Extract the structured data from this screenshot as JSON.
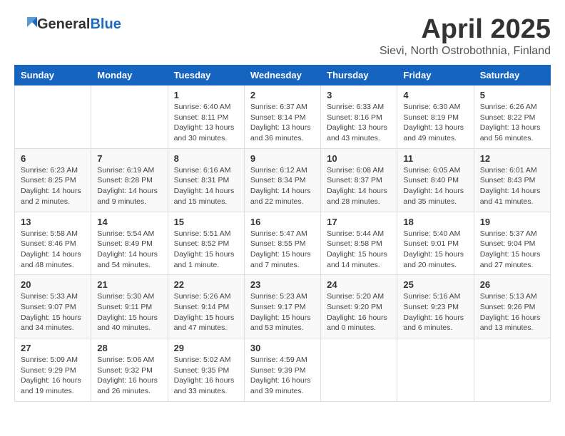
{
  "header": {
    "logo_general": "General",
    "logo_blue": "Blue",
    "title": "April 2025",
    "location": "Sievi, North Ostrobothnia, Finland"
  },
  "days_of_week": [
    "Sunday",
    "Monday",
    "Tuesday",
    "Wednesday",
    "Thursday",
    "Friday",
    "Saturday"
  ],
  "weeks": [
    [
      {
        "day": "",
        "info": ""
      },
      {
        "day": "",
        "info": ""
      },
      {
        "day": "1",
        "info": "Sunrise: 6:40 AM\nSunset: 8:11 PM\nDaylight: 13 hours and 30 minutes."
      },
      {
        "day": "2",
        "info": "Sunrise: 6:37 AM\nSunset: 8:14 PM\nDaylight: 13 hours and 36 minutes."
      },
      {
        "day": "3",
        "info": "Sunrise: 6:33 AM\nSunset: 8:16 PM\nDaylight: 13 hours and 43 minutes."
      },
      {
        "day": "4",
        "info": "Sunrise: 6:30 AM\nSunset: 8:19 PM\nDaylight: 13 hours and 49 minutes."
      },
      {
        "day": "5",
        "info": "Sunrise: 6:26 AM\nSunset: 8:22 PM\nDaylight: 13 hours and 56 minutes."
      }
    ],
    [
      {
        "day": "6",
        "info": "Sunrise: 6:23 AM\nSunset: 8:25 PM\nDaylight: 14 hours and 2 minutes."
      },
      {
        "day": "7",
        "info": "Sunrise: 6:19 AM\nSunset: 8:28 PM\nDaylight: 14 hours and 9 minutes."
      },
      {
        "day": "8",
        "info": "Sunrise: 6:16 AM\nSunset: 8:31 PM\nDaylight: 14 hours and 15 minutes."
      },
      {
        "day": "9",
        "info": "Sunrise: 6:12 AM\nSunset: 8:34 PM\nDaylight: 14 hours and 22 minutes."
      },
      {
        "day": "10",
        "info": "Sunrise: 6:08 AM\nSunset: 8:37 PM\nDaylight: 14 hours and 28 minutes."
      },
      {
        "day": "11",
        "info": "Sunrise: 6:05 AM\nSunset: 8:40 PM\nDaylight: 14 hours and 35 minutes."
      },
      {
        "day": "12",
        "info": "Sunrise: 6:01 AM\nSunset: 8:43 PM\nDaylight: 14 hours and 41 minutes."
      }
    ],
    [
      {
        "day": "13",
        "info": "Sunrise: 5:58 AM\nSunset: 8:46 PM\nDaylight: 14 hours and 48 minutes."
      },
      {
        "day": "14",
        "info": "Sunrise: 5:54 AM\nSunset: 8:49 PM\nDaylight: 14 hours and 54 minutes."
      },
      {
        "day": "15",
        "info": "Sunrise: 5:51 AM\nSunset: 8:52 PM\nDaylight: 15 hours and 1 minute."
      },
      {
        "day": "16",
        "info": "Sunrise: 5:47 AM\nSunset: 8:55 PM\nDaylight: 15 hours and 7 minutes."
      },
      {
        "day": "17",
        "info": "Sunrise: 5:44 AM\nSunset: 8:58 PM\nDaylight: 15 hours and 14 minutes."
      },
      {
        "day": "18",
        "info": "Sunrise: 5:40 AM\nSunset: 9:01 PM\nDaylight: 15 hours and 20 minutes."
      },
      {
        "day": "19",
        "info": "Sunrise: 5:37 AM\nSunset: 9:04 PM\nDaylight: 15 hours and 27 minutes."
      }
    ],
    [
      {
        "day": "20",
        "info": "Sunrise: 5:33 AM\nSunset: 9:07 PM\nDaylight: 15 hours and 34 minutes."
      },
      {
        "day": "21",
        "info": "Sunrise: 5:30 AM\nSunset: 9:11 PM\nDaylight: 15 hours and 40 minutes."
      },
      {
        "day": "22",
        "info": "Sunrise: 5:26 AM\nSunset: 9:14 PM\nDaylight: 15 hours and 47 minutes."
      },
      {
        "day": "23",
        "info": "Sunrise: 5:23 AM\nSunset: 9:17 PM\nDaylight: 15 hours and 53 minutes."
      },
      {
        "day": "24",
        "info": "Sunrise: 5:20 AM\nSunset: 9:20 PM\nDaylight: 16 hours and 0 minutes."
      },
      {
        "day": "25",
        "info": "Sunrise: 5:16 AM\nSunset: 9:23 PM\nDaylight: 16 hours and 6 minutes."
      },
      {
        "day": "26",
        "info": "Sunrise: 5:13 AM\nSunset: 9:26 PM\nDaylight: 16 hours and 13 minutes."
      }
    ],
    [
      {
        "day": "27",
        "info": "Sunrise: 5:09 AM\nSunset: 9:29 PM\nDaylight: 16 hours and 19 minutes."
      },
      {
        "day": "28",
        "info": "Sunrise: 5:06 AM\nSunset: 9:32 PM\nDaylight: 16 hours and 26 minutes."
      },
      {
        "day": "29",
        "info": "Sunrise: 5:02 AM\nSunset: 9:35 PM\nDaylight: 16 hours and 33 minutes."
      },
      {
        "day": "30",
        "info": "Sunrise: 4:59 AM\nSunset: 9:39 PM\nDaylight: 16 hours and 39 minutes."
      },
      {
        "day": "",
        "info": ""
      },
      {
        "day": "",
        "info": ""
      },
      {
        "day": "",
        "info": ""
      }
    ]
  ]
}
